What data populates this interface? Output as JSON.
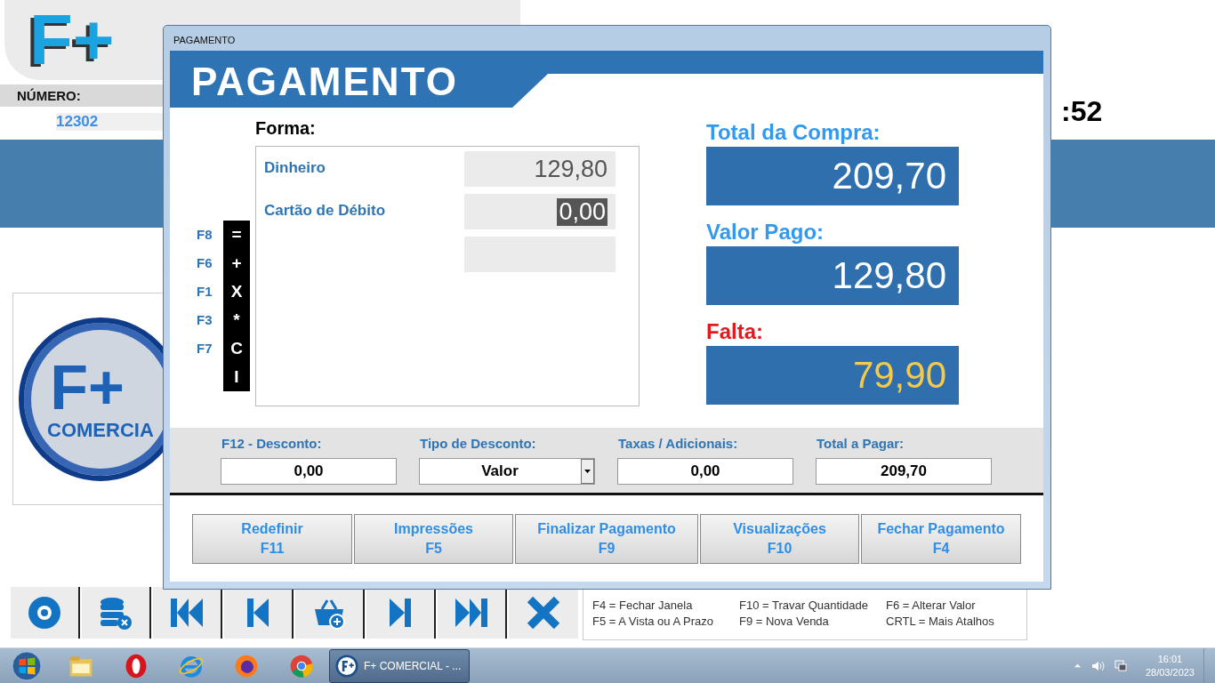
{
  "app": {
    "logo_text": "F+",
    "number_label": "NÚMERO:",
    "number_value": "12302",
    "clock_fragment": ":52",
    "side_logo": {
      "mark": "F+",
      "name": "COMERCIA"
    },
    "shortcuts": [
      "F4 = Fechar Janela",
      "F10 = Travar Quantidade",
      "F6 = Alterar Valor",
      "F5 = A Vista ou A Prazo",
      "F9 = Nova Venda",
      "CRTL = Mais Atalhos"
    ]
  },
  "dialog": {
    "title": "PAGAMENTO",
    "banner": "PAGAMENTO",
    "forma_label": "Forma:",
    "keys": [
      {
        "key": "F8",
        "symbol": "="
      },
      {
        "key": "F6",
        "symbol": "+"
      },
      {
        "key": "F1",
        "symbol": "X"
      },
      {
        "key": "F3",
        "symbol": "*"
      },
      {
        "key": "F7",
        "symbol": "C"
      },
      {
        "symbol": "I"
      }
    ],
    "payments": [
      {
        "kind": "entry",
        "name": "Dinheiro",
        "value": "129,80",
        "selected": false
      },
      {
        "kind": "entry",
        "name": "Cartão de Débito",
        "value": "0,00",
        "selected": true
      },
      {
        "kind": "empty"
      }
    ],
    "totals": [
      {
        "label": "Total da Compra:",
        "value": "209,70",
        "kind": "normal"
      },
      {
        "label": "Valor Pago:",
        "value": "129,80",
        "kind": "normal"
      },
      {
        "label": "Falta:",
        "value": "79,90",
        "kind": "due"
      }
    ],
    "fields": [
      {
        "label": "F12 - Desconto:",
        "value": "0,00",
        "kind": "text"
      },
      {
        "label": "Tipo de Desconto:",
        "value": "Valor",
        "kind": "dropdown"
      },
      {
        "label": "Taxas / Adicionais:",
        "value": "0,00",
        "kind": "text"
      },
      {
        "label": "Total a Pagar:",
        "value": "209,70",
        "kind": "text"
      }
    ],
    "buttons": [
      {
        "label": "Redefinir",
        "key": "F11"
      },
      {
        "label": "Impressões",
        "key": "F5"
      },
      {
        "label": "Finalizar Pagamento",
        "key": "F9"
      },
      {
        "label": "Visualizações",
        "key": "F10"
      },
      {
        "label": "Fechar Pagamento",
        "key": "F4"
      }
    ]
  },
  "taskbar": {
    "tasks": [
      {
        "label": "F+ COMERCIAL - ...",
        "selected": true
      }
    ],
    "time": "16:01",
    "date": "28/03/2023"
  }
}
